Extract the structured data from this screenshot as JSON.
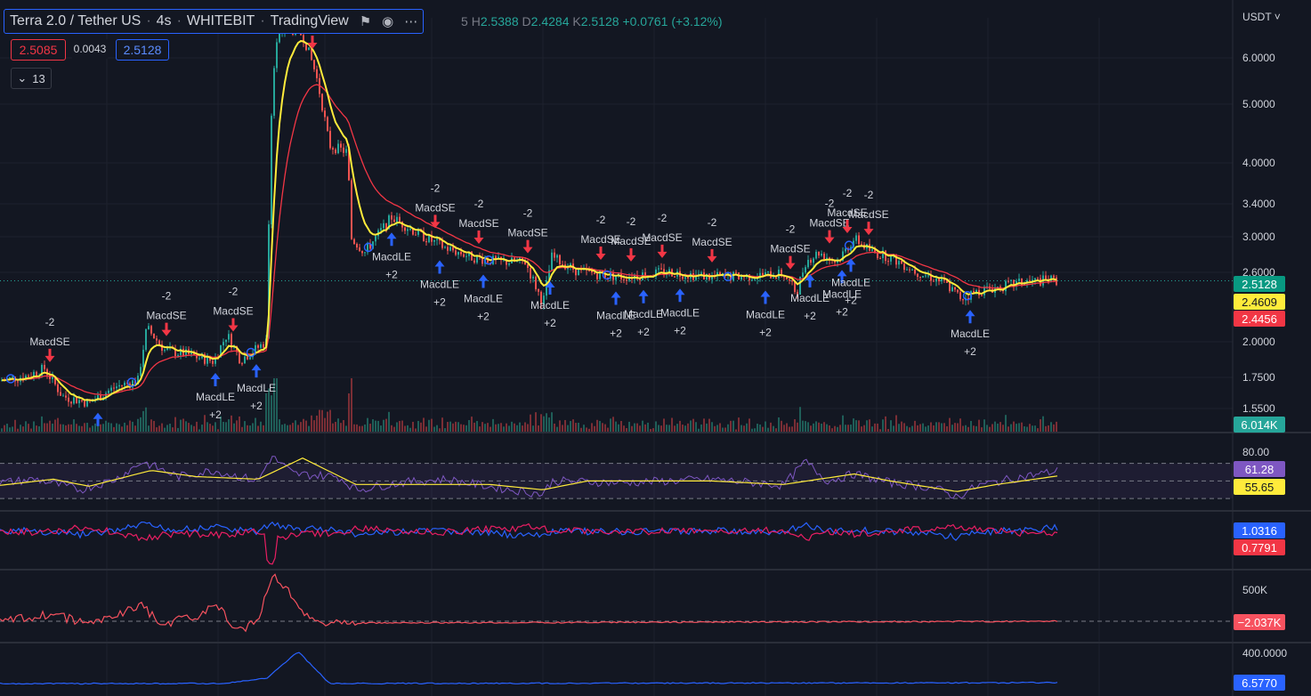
{
  "header": {
    "symbol": "Terra 2.0 / Tether US",
    "interval": "4s",
    "exchange": "WHITEBIT",
    "platform": "TradingView",
    "icons": [
      "flag-icon",
      "eye-icon",
      "more-icon"
    ]
  },
  "ohlc": {
    "h_label": "H",
    "h_value": "2.5388",
    "l_label": "D",
    "l_value": "2.4284",
    "c_label": "K",
    "c_value": "2.5128",
    "change": "+0.0761 (+3.12%)"
  },
  "indicators": {
    "value_red": "2.5085",
    "value_plain": "0.0043",
    "value_blue": "2.5128",
    "collapse_count": "13"
  },
  "axis": {
    "currency": "USDT",
    "price_ticks": [
      "6.0000",
      "5.0000",
      "4.0000",
      "3.4000",
      "3.0000",
      "2.6000",
      "2.0000",
      "1.7500",
      "1.5500"
    ],
    "rsi_ticks": [
      "80.00"
    ],
    "osc_ticks": [
      "500K"
    ],
    "last_ticks": [
      "400.0000"
    ]
  },
  "tags": {
    "last_price": "2.5128",
    "ma_fast": "2.4609",
    "ma_slow": "2.4456",
    "volume": "6.014K",
    "rsi": "61.28",
    "rsi_ma": "55.65",
    "di_plus": "1.0316",
    "di_minus": "0.7791",
    "osc": "−2.037K",
    "last_ind": "6.5770"
  },
  "colors": {
    "background": "#131722",
    "up": "#26a69a",
    "down": "#ef5350",
    "ma_fast": "#ffeb3b",
    "ma_slow": "#f23645",
    "accent": "#2962ff",
    "rsi": "#7e57c2"
  },
  "chart_data": {
    "type": "candlestick",
    "y_scale": "log",
    "ylim": [
      1.5,
      6.6
    ],
    "price_path": [
      [
        0,
        1.72
      ],
      [
        30,
        1.75
      ],
      [
        50,
        1.8
      ],
      [
        70,
        1.62
      ],
      [
        100,
        1.58
      ],
      [
        130,
        1.68
      ],
      [
        155,
        1.72
      ],
      [
        165,
        2.1
      ],
      [
        185,
        1.93
      ],
      [
        210,
        1.9
      ],
      [
        240,
        1.85
      ],
      [
        255,
        2.05
      ],
      [
        270,
        1.86
      ],
      [
        290,
        1.95
      ],
      [
        300,
        2.0
      ],
      [
        305,
        4.8
      ],
      [
        310,
        6.2
      ],
      [
        320,
        6.6
      ],
      [
        340,
        6.4
      ],
      [
        355,
        5.5
      ],
      [
        370,
        4.2
      ],
      [
        390,
        4.1
      ],
      [
        395,
        2.95
      ],
      [
        410,
        2.8
      ],
      [
        440,
        3.2
      ],
      [
        470,
        3.0
      ],
      [
        500,
        2.85
      ],
      [
        530,
        2.75
      ],
      [
        560,
        2.7
      ],
      [
        590,
        2.7
      ],
      [
        610,
        2.3
      ],
      [
        620,
        2.75
      ],
      [
        650,
        2.6
      ],
      [
        700,
        2.55
      ],
      [
        750,
        2.6
      ],
      [
        800,
        2.55
      ],
      [
        850,
        2.56
      ],
      [
        880,
        2.58
      ],
      [
        895,
        2.4
      ],
      [
        905,
        2.7
      ],
      [
        920,
        2.8
      ],
      [
        940,
        2.7
      ],
      [
        960,
        2.95
      ],
      [
        980,
        2.8
      ],
      [
        1000,
        2.75
      ],
      [
        1030,
        2.6
      ],
      [
        1060,
        2.5
      ],
      [
        1080,
        2.35
      ],
      [
        1100,
        2.42
      ],
      [
        1120,
        2.45
      ],
      [
        1150,
        2.5
      ],
      [
        1180,
        2.52
      ],
      [
        1188,
        2.5128
      ]
    ],
    "signals": [
      {
        "x": 56,
        "type": "sell",
        "text": [
          "-2",
          "MacdSE"
        ]
      },
      {
        "x": 110,
        "type": "buy",
        "text": []
      },
      {
        "x": 187,
        "type": "sell",
        "text": [
          "-2",
          "MacdSE"
        ]
      },
      {
        "x": 242,
        "type": "buy",
        "text": [
          "MacdLE",
          "+2"
        ]
      },
      {
        "x": 262,
        "type": "sell",
        "text": [
          "-2",
          "MacdSE"
        ]
      },
      {
        "x": 288,
        "type": "buy",
        "text": [
          "MacdLE",
          "+2"
        ]
      },
      {
        "x": 351,
        "type": "sell",
        "text": []
      },
      {
        "x": 440,
        "type": "buy",
        "text": [
          "MacdLE",
          "+2"
        ]
      },
      {
        "x": 489,
        "type": "sell",
        "text": [
          "-2",
          "MacdSE"
        ]
      },
      {
        "x": 494,
        "type": "buy",
        "text": [
          "MacdLE",
          "+2"
        ]
      },
      {
        "x": 538,
        "type": "sell",
        "text": [
          "-2",
          "MacdSE"
        ]
      },
      {
        "x": 543,
        "type": "buy",
        "text": [
          "MacdLE",
          "+2"
        ]
      },
      {
        "x": 593,
        "type": "sell",
        "text": [
          "-2",
          "MacdSE"
        ]
      },
      {
        "x": 618,
        "type": "buy",
        "text": [
          "MacdLE",
          "+2"
        ]
      },
      {
        "x": 675,
        "type": "sell",
        "text": [
          "-2",
          "MacdSE"
        ]
      },
      {
        "x": 692,
        "type": "buy",
        "text": [
          "MacdLE",
          "+2"
        ]
      },
      {
        "x": 709,
        "type": "sell",
        "text": [
          "-2",
          "MacdSE"
        ]
      },
      {
        "x": 723,
        "type": "buy",
        "text": [
          "MacdLE",
          "+2"
        ]
      },
      {
        "x": 744,
        "type": "sell",
        "text": [
          "-2",
          "MacdSE"
        ]
      },
      {
        "x": 764,
        "type": "buy",
        "text": [
          "MacdLE",
          "+2"
        ]
      },
      {
        "x": 800,
        "type": "sell",
        "text": [
          "-2",
          "MacdSE"
        ]
      },
      {
        "x": 860,
        "type": "buy",
        "text": [
          "MacdLE",
          "+2"
        ]
      },
      {
        "x": 888,
        "type": "sell",
        "text": [
          "-2",
          "MacdSE"
        ]
      },
      {
        "x": 910,
        "type": "buy",
        "text": [
          "MacdLE",
          "+2"
        ]
      },
      {
        "x": 932,
        "type": "sell",
        "text": [
          "-2",
          "MacdSE"
        ]
      },
      {
        "x": 946,
        "type": "buy",
        "text": [
          "MacdLE",
          "+2"
        ]
      },
      {
        "x": 952,
        "type": "sell",
        "text": [
          "-2",
          "MacdSE"
        ]
      },
      {
        "x": 956,
        "type": "buy",
        "text": [
          "MacdLE",
          "+2"
        ]
      },
      {
        "x": 976,
        "type": "sell",
        "text": [
          "-2",
          "MacdSE"
        ]
      },
      {
        "x": 1090,
        "type": "buy",
        "text": [
          "MacdLE",
          "+2"
        ]
      }
    ],
    "rsi_range": [
      20,
      95
    ],
    "rsi_path": [
      [
        0,
        48
      ],
      [
        40,
        52
      ],
      [
        90,
        40
      ],
      [
        130,
        52
      ],
      [
        160,
        72
      ],
      [
        200,
        55
      ],
      [
        240,
        62
      ],
      [
        290,
        50
      ],
      [
        305,
        78
      ],
      [
        330,
        58
      ],
      [
        380,
        55
      ],
      [
        400,
        40
      ],
      [
        450,
        48
      ],
      [
        500,
        52
      ],
      [
        560,
        42
      ],
      [
        610,
        35
      ],
      [
        620,
        50
      ],
      [
        700,
        48
      ],
      [
        800,
        52
      ],
      [
        880,
        45
      ],
      [
        905,
        72
      ],
      [
        930,
        50
      ],
      [
        960,
        58
      ],
      [
        1000,
        48
      ],
      [
        1050,
        42
      ],
      [
        1075,
        32
      ],
      [
        1100,
        45
      ],
      [
        1150,
        55
      ],
      [
        1188,
        61.28
      ]
    ],
    "rsi_ma_path": [
      [
        0,
        45
      ],
      [
        60,
        52
      ],
      [
        100,
        44
      ],
      [
        170,
        62
      ],
      [
        220,
        55
      ],
      [
        290,
        52
      ],
      [
        340,
        76
      ],
      [
        400,
        46
      ],
      [
        450,
        46
      ],
      [
        550,
        46
      ],
      [
        610,
        40
      ],
      [
        660,
        50
      ],
      [
        800,
        50
      ],
      [
        880,
        46
      ],
      [
        960,
        58
      ],
      [
        1000,
        50
      ],
      [
        1075,
        38
      ],
      [
        1120,
        46
      ],
      [
        1188,
        55.65
      ]
    ]
  }
}
